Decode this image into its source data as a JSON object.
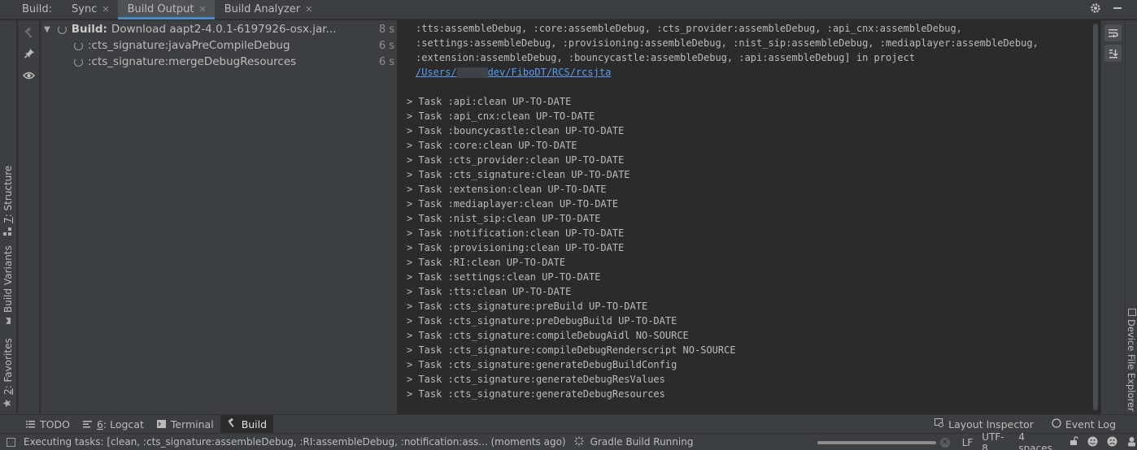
{
  "topbar": {
    "label": "Build:",
    "tabs": [
      {
        "label": "Sync",
        "active": false
      },
      {
        "label": "Build Output",
        "active": true
      },
      {
        "label": "Build Analyzer",
        "active": false
      }
    ],
    "close_glyph": "✕"
  },
  "left_stripe": {
    "structure_label_num": "7",
    "structure_label_rest": ": Structure",
    "build_variants_label": "Build Variants",
    "favorites_label_num": "2",
    "favorites_label_rest": ": Favorites"
  },
  "tree": {
    "root": {
      "prefix": "Build:",
      "label": "Download aapt2-4.0.1-6197926-osx.jar...",
      "duration": "8 s"
    },
    "children": [
      {
        "label": ":cts_signature:javaPreCompileDebug",
        "duration": "6 s"
      },
      {
        "label": ":cts_signature:mergeDebugResources",
        "duration": "6 s"
      }
    ]
  },
  "console": {
    "lines": [
      ":tts:assembleDebug, :core:assembleDebug, :cts_provider:assembleDebug, :api_cnx:assembleDebug,",
      ":settings:assembleDebug, :provisioning:assembleDebug, :nist_sip:assembleDebug, :mediaplayer:assembleDebug,",
      ":extension:assembleDebug, :bouncycastle:assembleDebug, :api:assembleDebug] in project"
    ],
    "link_prefix": "/Users/",
    "link_suffix": "dev/FiboDT/RCS/rcsjta",
    "tasks": [
      "> Task :api:clean UP-TO-DATE",
      "> Task :api_cnx:clean UP-TO-DATE",
      "> Task :bouncycastle:clean UP-TO-DATE",
      "> Task :core:clean UP-TO-DATE",
      "> Task :cts_provider:clean UP-TO-DATE",
      "> Task :cts_signature:clean UP-TO-DATE",
      "> Task :extension:clean UP-TO-DATE",
      "> Task :mediaplayer:clean UP-TO-DATE",
      "> Task :nist_sip:clean UP-TO-DATE",
      "> Task :notification:clean UP-TO-DATE",
      "> Task :provisioning:clean UP-TO-DATE",
      "> Task :RI:clean UP-TO-DATE",
      "> Task :settings:clean UP-TO-DATE",
      "> Task :tts:clean UP-TO-DATE",
      "> Task :cts_signature:preBuild UP-TO-DATE",
      "> Task :cts_signature:preDebugBuild UP-TO-DATE",
      "> Task :cts_signature:compileDebugAidl NO-SOURCE",
      "> Task :cts_signature:compileDebugRenderscript NO-SOURCE",
      "> Task :cts_signature:generateDebugBuildConfig",
      "> Task :cts_signature:generateDebugResValues",
      "> Task :cts_signature:generateDebugResources"
    ]
  },
  "right_stripe": {
    "device_file_explorer": "Device File Explorer"
  },
  "bottombar": {
    "todo": "TODO",
    "logcat_num": "6",
    "logcat_rest": ": Logcat",
    "terminal": "Terminal",
    "build": "Build",
    "layout_inspector": "Layout Inspector",
    "event_log": "Event Log"
  },
  "status": {
    "message": "Executing tasks: [clean, :cts_signature:assembleDebug, :RI:assembleDebug, :notification:ass... (moments ago)",
    "gradle": "Gradle Build Running",
    "progress": 1.0,
    "line_sep": "LF",
    "encoding": "UTF-8",
    "indent": "4 spaces"
  },
  "colors": {
    "accent": "#4a88c7",
    "link": "#589df6",
    "bg": "#2b2b2b",
    "panel": "#3c3f41"
  }
}
